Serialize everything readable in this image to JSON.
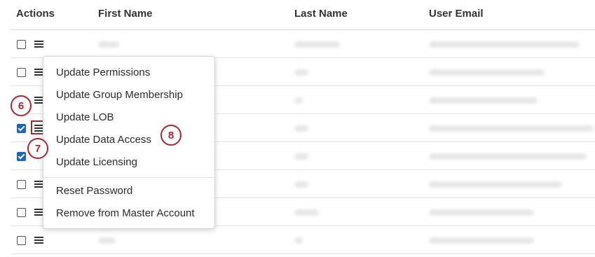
{
  "table": {
    "headers": {
      "actions": "Actions",
      "first_name": "First Name",
      "last_name": "Last Name",
      "user_email": "User Email"
    },
    "rows": [
      {
        "checked": false
      },
      {
        "checked": false
      },
      {
        "checked": false
      },
      {
        "checked": true
      },
      {
        "checked": true
      },
      {
        "checked": false
      },
      {
        "checked": false
      },
      {
        "checked": false
      }
    ]
  },
  "actions_menu": {
    "items": [
      "Update Permissions",
      "Update Group Membership",
      "Update LOB",
      "Update Data Access",
      "Update Licensing"
    ],
    "secondary_items": [
      "Reset Password",
      "Remove from Master Account"
    ]
  },
  "callouts": {
    "six": "6",
    "seven": "7",
    "eight": "8"
  },
  "colors": {
    "callout": "#b3232f",
    "checkbox_checked": "#1c63c4"
  }
}
